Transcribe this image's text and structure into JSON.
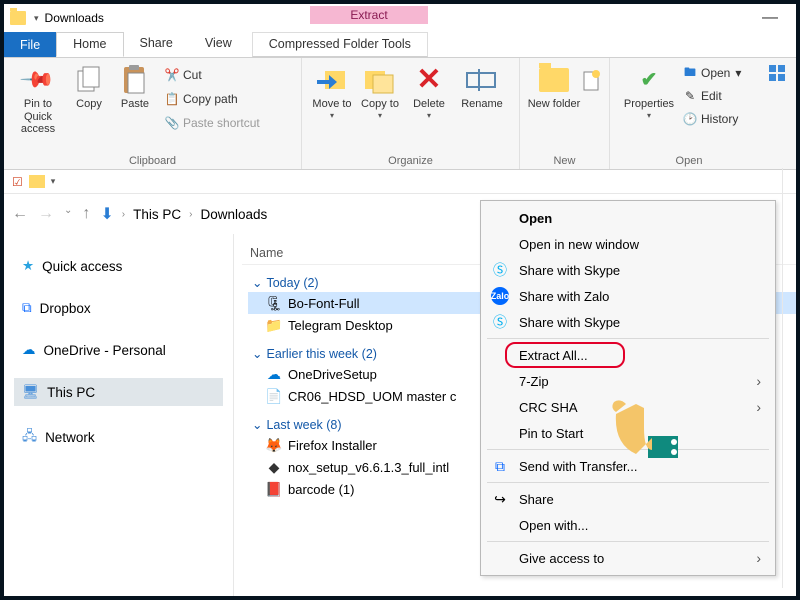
{
  "titlebar": {
    "title": "Downloads"
  },
  "contextual_tab": {
    "highlight": "Extract",
    "label": "Compressed Folder Tools"
  },
  "tabs": {
    "file": "File",
    "home": "Home",
    "share": "Share",
    "view": "View"
  },
  "ribbon": {
    "clipboard": {
      "title": "Clipboard",
      "pin": "Pin to Quick access",
      "copy": "Copy",
      "paste": "Paste",
      "cut": "Cut",
      "copy_path": "Copy path",
      "paste_shortcut": "Paste shortcut"
    },
    "organize": {
      "title": "Organize",
      "move_to": "Move to",
      "copy_to": "Copy to",
      "delete": "Delete",
      "rename": "Rename"
    },
    "new": {
      "title": "New",
      "new_folder": "New folder"
    },
    "open": {
      "title": "Open",
      "properties": "Properties",
      "open": "Open",
      "edit": "Edit",
      "history": "History"
    }
  },
  "breadcrumb": {
    "pc": "This PC",
    "folder": "Downloads"
  },
  "sidebar": {
    "quick_access": "Quick access",
    "dropbox": "Dropbox",
    "onedrive": "OneDrive - Personal",
    "this_pc": "This PC",
    "network": "Network"
  },
  "content": {
    "col_name": "Name",
    "groups": [
      {
        "title": "Today (2)",
        "items": [
          {
            "name": "Bo-Font-Full",
            "selected": true,
            "icon": "zip"
          },
          {
            "name": "Telegram Desktop",
            "icon": "folder"
          }
        ]
      },
      {
        "title": "Earlier this week (2)",
        "items": [
          {
            "name": "OneDriveSetup",
            "icon": "cloud"
          },
          {
            "name": "CR06_HDSD_UOM master c",
            "icon": "word"
          }
        ]
      },
      {
        "title": "Last week (8)",
        "items": [
          {
            "name": "Firefox Installer",
            "icon": "firefox"
          },
          {
            "name": "nox_setup_v6.6.1.3_full_intl",
            "icon": "nox"
          },
          {
            "name": "barcode (1)",
            "icon": "pdf"
          }
        ]
      }
    ]
  },
  "context_menu": {
    "open": "Open",
    "open_new": "Open in new window",
    "share_skype": "Share with Skype",
    "share_zalo": "Share with Zalo",
    "share_skype2": "Share with Skype",
    "extract_all": "Extract All...",
    "seven_zip": "7-Zip",
    "crc_sha": "CRC SHA",
    "pin_start": "Pin to Start",
    "send_transfer": "Send with Transfer...",
    "share": "Share",
    "open_with": "Open with...",
    "give_access": "Give access to"
  }
}
